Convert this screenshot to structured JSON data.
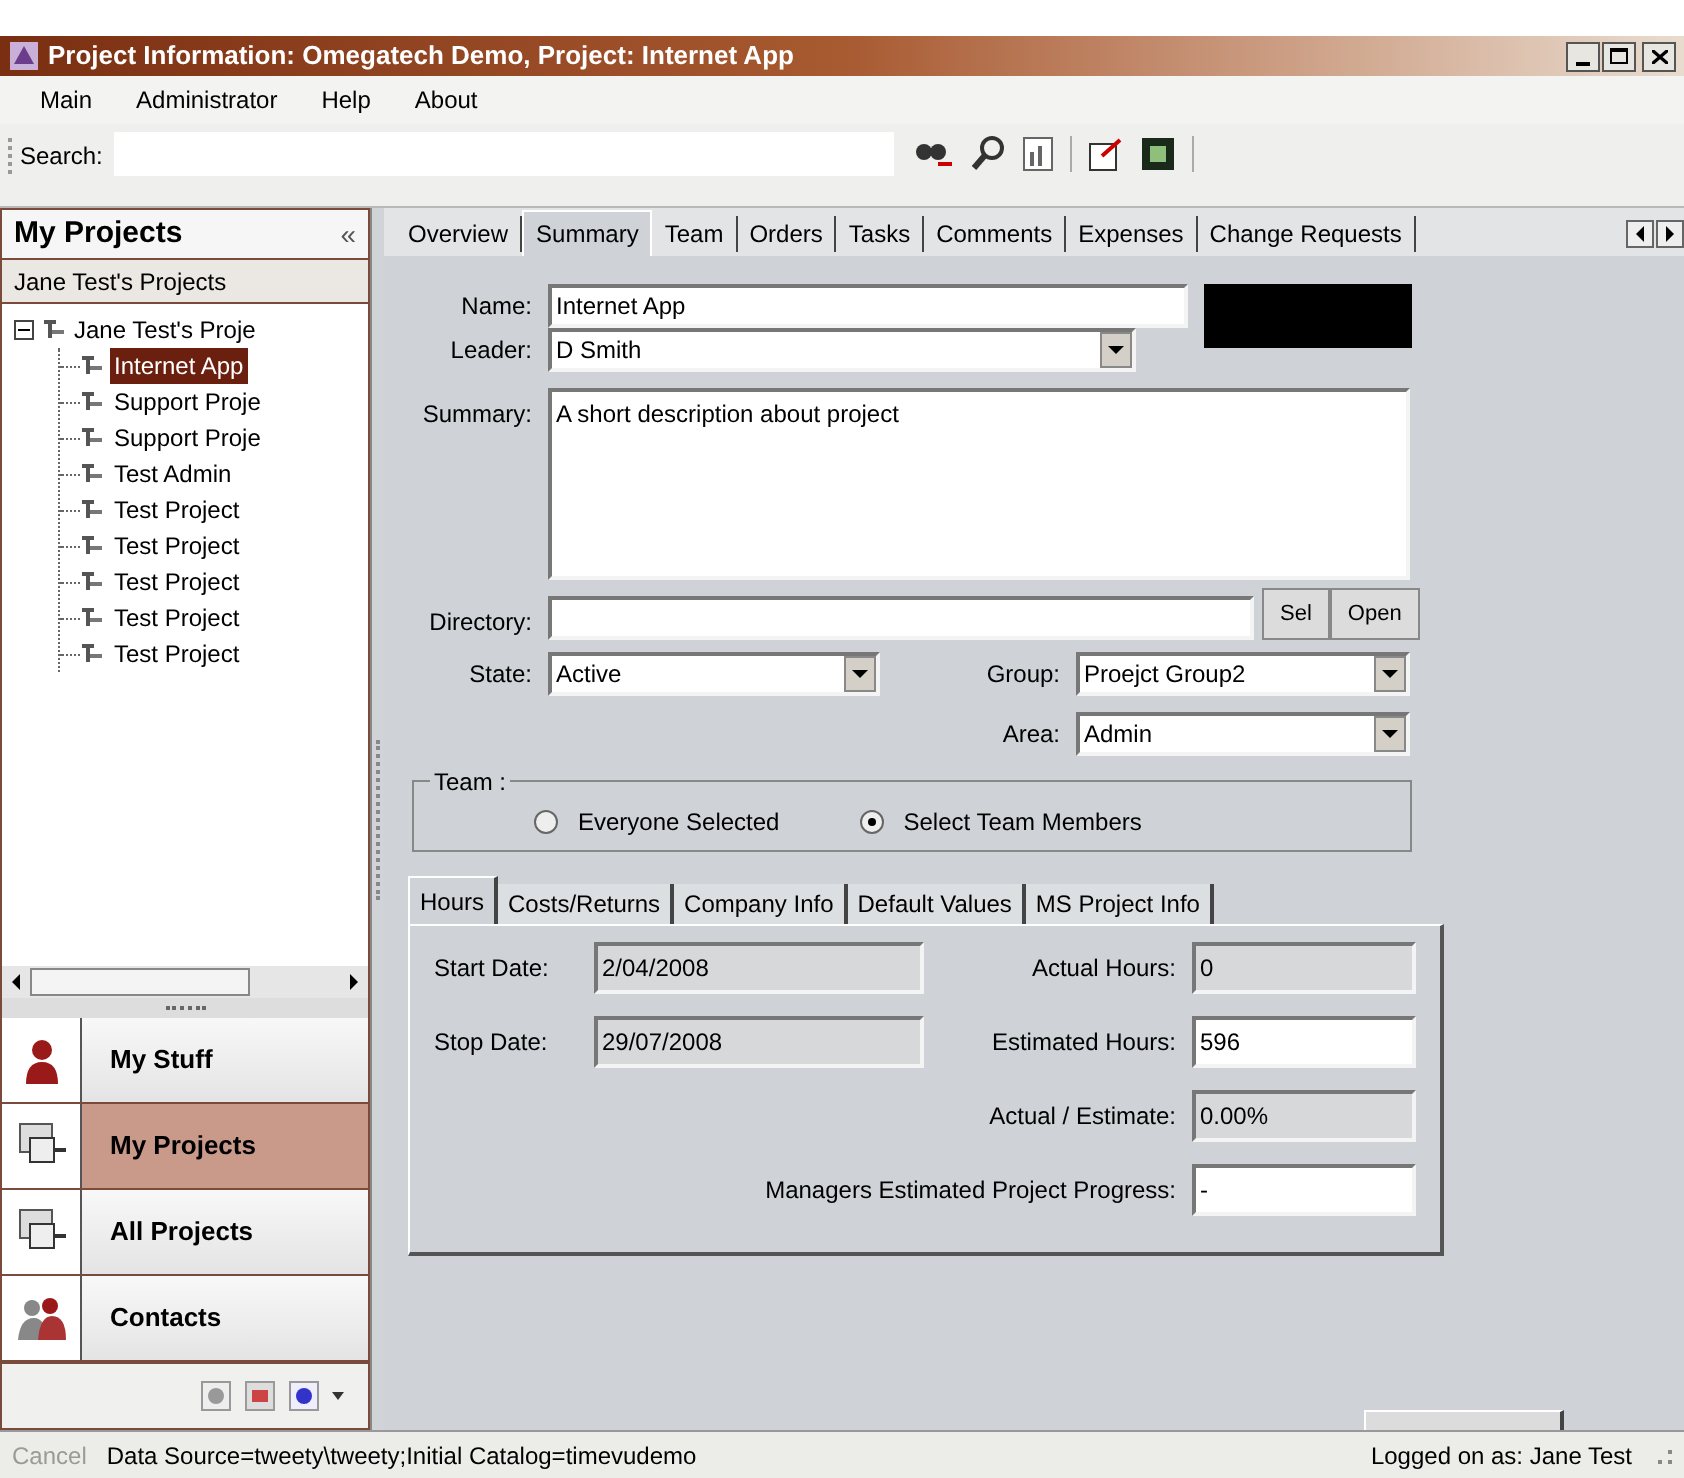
{
  "window": {
    "title": "Project Information: Omegatech Demo, Project: Internet App"
  },
  "menu": [
    "Main",
    "Administrator",
    "Help",
    "About"
  ],
  "toolbar": {
    "search_label": "Search:"
  },
  "sidebar": {
    "title": "My Projects",
    "collapse": "«",
    "subheader": "Jane Test's Projects",
    "tree": [
      {
        "label": "Jane Test's Proje",
        "expanded": true,
        "children": [
          {
            "label": "Internet App",
            "selected": true
          },
          {
            "label": "Support Proje",
            "selected": false
          },
          {
            "label": "Support Proje",
            "selected": false
          },
          {
            "label": "Test Admin",
            "selected": false
          },
          {
            "label": "Test Project",
            "selected": false
          },
          {
            "label": "Test Project",
            "selected": false
          },
          {
            "label": "Test Project",
            "selected": false
          },
          {
            "label": "Test Project",
            "selected": false
          },
          {
            "label": "Test Project",
            "selected": false
          }
        ]
      }
    ],
    "nav": [
      {
        "label": "My Stuff",
        "kind": "person",
        "selected": false
      },
      {
        "label": "My Projects",
        "kind": "projects",
        "selected": true
      },
      {
        "label": "All Projects",
        "kind": "projects",
        "selected": false
      },
      {
        "label": "Contacts",
        "kind": "people",
        "selected": false
      }
    ]
  },
  "tabs": [
    {
      "label": "Overview",
      "selected": false
    },
    {
      "label": "Summary",
      "selected": true
    },
    {
      "label": "Team",
      "selected": false
    },
    {
      "label": "Orders",
      "selected": false
    },
    {
      "label": "Tasks",
      "selected": false
    },
    {
      "label": "Comments",
      "selected": false
    },
    {
      "label": "Expenses",
      "selected": false
    },
    {
      "label": "Change Requests",
      "selected": false
    }
  ],
  "form": {
    "name": {
      "label": "Name:",
      "value": "Internet App"
    },
    "leader": {
      "label": "Leader:",
      "value": "D Smith"
    },
    "summary": {
      "label": "Summary:",
      "value": "A short description about project"
    },
    "directory": {
      "label": "Directory:",
      "buttons": [
        "Sel",
        "Open"
      ]
    },
    "state": {
      "label": "State:",
      "value": "Active"
    },
    "group": {
      "label": "Group:",
      "value": "Proejct Group2"
    },
    "area": {
      "label": "Area:",
      "value": "Admin"
    },
    "team": {
      "legend": "Team :",
      "options": [
        {
          "label": "Everyone Selected",
          "selected": false
        },
        {
          "label": "Select Team Members",
          "selected": true
        }
      ]
    }
  },
  "subtabs": [
    {
      "label": "Hours",
      "selected": true
    },
    {
      "label": "Costs/Returns",
      "selected": false
    },
    {
      "label": "Company Info",
      "selected": false
    },
    {
      "label": "Default Values",
      "selected": false
    },
    {
      "label": "MS Project Info",
      "selected": false
    }
  ],
  "hours": {
    "left": [
      {
        "label": "Start Date:",
        "value": "2/04/2008",
        "readonly": true
      },
      {
        "label": "Stop Date:",
        "value": "29/07/2008",
        "readonly": true
      }
    ],
    "right": [
      {
        "label": "Actual Hours:",
        "value": "0",
        "readonly": true
      },
      {
        "label": "Estimated Hours:",
        "value": "596",
        "readonly": false
      },
      {
        "label": "Actual / Estimate:",
        "value": "0.00%",
        "readonly": true
      },
      {
        "label": "Managers Estimated Project Progress:",
        "value": "-",
        "readonly": false
      }
    ]
  },
  "status_bar": {
    "cancel": {
      "label": "Cancel",
      "disabled": true
    },
    "connection": "Data Source=tweety\\tweety;Initial Catalog=timevudemo",
    "user": "Logged on as: Jane Test"
  }
}
